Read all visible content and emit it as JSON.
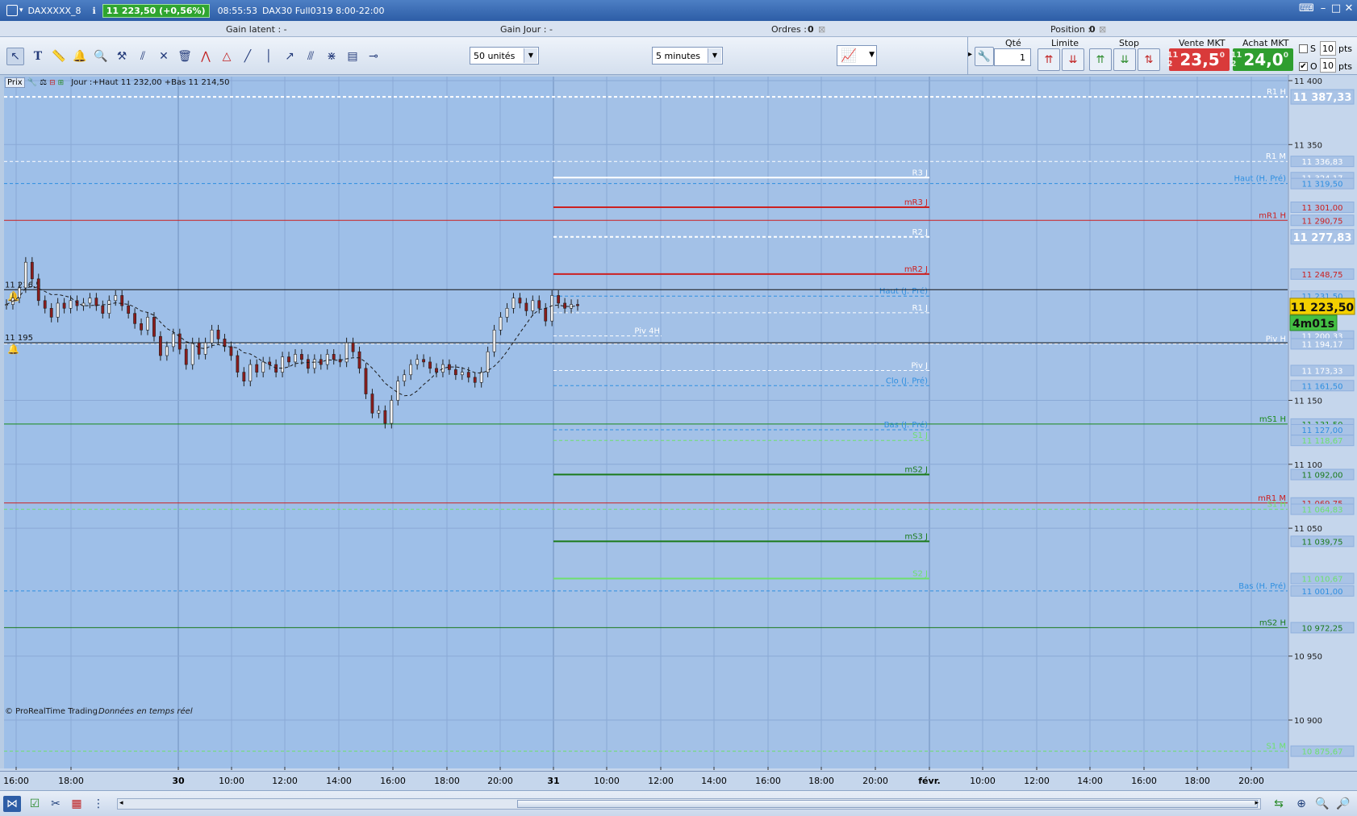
{
  "window": {
    "instrument": "DAXXXXX_8",
    "change": "11 223,50 (+0,56%)",
    "time": "08:55:53",
    "contract": "DAX30 Full0319 8:00-22:00"
  },
  "infobar": {
    "gain_latent": "Gain latent :  -",
    "gain_jour": "Gain Jour :  -",
    "ordres": "Ordres :",
    "ordres_value": "0",
    "position": "Position :",
    "position_value": "0"
  },
  "toolbar": {
    "units_select": "50 unités",
    "timeframe_select": "5 minutes",
    "qty_label": "Qté",
    "qty_value": "1",
    "limit_label": "Limite",
    "stop_label": "Stop",
    "sell_label": "Vente MKT",
    "buy_label": "Achat MKT",
    "sell_prefix": "11 2",
    "sell_price": "23,5",
    "sell_suffix": "0",
    "buy_prefix": "11 2",
    "buy_price": "24,0",
    "buy_suffix": "0",
    "s_label": "S",
    "o_label": "O",
    "s_value": "10",
    "o_value": "10",
    "pts_label": "pts",
    "colors": {
      "sell": "#d93a3a",
      "buy": "#2f9e2f"
    }
  },
  "chart_header": {
    "prix_label": "Prix",
    "jour_text": "Jour :+Haut 11 232,00 +Bas 11 214,50"
  },
  "chart_data": {
    "type": "candlestick",
    "ylim": [
      10870,
      11412
    ],
    "y_ticks": [
      "11 400",
      "11 350",
      "11 150",
      "11 100",
      "11 050",
      "10 950",
      "10 900"
    ],
    "y_tick_values": [
      11400,
      11350,
      11150,
      11100,
      11050,
      10950,
      10900
    ],
    "x_ticks": [
      "16:00",
      "18:00",
      "30",
      "10:00",
      "12:00",
      "14:00",
      "16:00",
      "18:00",
      "20:00",
      "31",
      "10:00",
      "12:00",
      "14:00",
      "16:00",
      "18:00",
      "20:00",
      "févr.",
      "10:00",
      "12:00",
      "14:00",
      "16:00",
      "18:00",
      "20:00"
    ],
    "x_tick_bold": [
      false,
      false,
      true,
      false,
      false,
      false,
      false,
      false,
      false,
      true,
      false,
      false,
      false,
      false,
      false,
      false,
      true,
      false,
      false,
      false,
      false,
      false,
      false
    ],
    "last_price": "11 223,50",
    "countdown": "4m01s",
    "alerts": [
      {
        "label": "11 236,5",
        "value": 11236.5
      },
      {
        "label": "11 195",
        "value": 11195
      }
    ],
    "close_path": [
      [
        0,
        11225
      ],
      [
        2,
        11230
      ],
      [
        4,
        11238
      ],
      [
        6,
        11258
      ],
      [
        8,
        11245
      ],
      [
        10,
        11228
      ],
      [
        12,
        11222
      ],
      [
        14,
        11215
      ],
      [
        16,
        11226
      ],
      [
        18,
        11222
      ],
      [
        20,
        11228
      ],
      [
        22,
        11224
      ],
      [
        24,
        11226
      ],
      [
        26,
        11230
      ],
      [
        28,
        11224
      ],
      [
        30,
        11218
      ],
      [
        32,
        11228
      ],
      [
        34,
        11232
      ],
      [
        36,
        11224
      ],
      [
        38,
        11218
      ],
      [
        40,
        11210
      ],
      [
        42,
        11205
      ],
      [
        44,
        11215
      ],
      [
        46,
        11200
      ],
      [
        48,
        11185
      ],
      [
        50,
        11192
      ],
      [
        52,
        11202
      ],
      [
        54,
        11190
      ],
      [
        56,
        11178
      ],
      [
        58,
        11195
      ],
      [
        60,
        11186
      ],
      [
        62,
        11195
      ],
      [
        64,
        11205
      ],
      [
        66,
        11198
      ],
      [
        68,
        11192
      ],
      [
        70,
        11185
      ],
      [
        72,
        11172
      ],
      [
        74,
        11165
      ],
      [
        76,
        11178
      ],
      [
        78,
        11172
      ],
      [
        80,
        11180
      ],
      [
        82,
        11178
      ],
      [
        84,
        11172
      ],
      [
        86,
        11184
      ],
      [
        88,
        11180
      ],
      [
        90,
        11186
      ],
      [
        92,
        11182
      ],
      [
        94,
        11175
      ],
      [
        96,
        11182
      ],
      [
        98,
        11178
      ],
      [
        100,
        11186
      ],
      [
        102,
        11182
      ],
      [
        104,
        11180
      ],
      [
        106,
        11195
      ],
      [
        108,
        11188
      ],
      [
        110,
        11175
      ],
      [
        112,
        11155
      ],
      [
        114,
        11140
      ],
      [
        116,
        11142
      ],
      [
        118,
        11132
      ],
      [
        120,
        11150
      ],
      [
        122,
        11165
      ],
      [
        124,
        11170
      ],
      [
        126,
        11178
      ],
      [
        128,
        11182
      ],
      [
        130,
        11180
      ],
      [
        132,
        11175
      ],
      [
        134,
        11172
      ],
      [
        136,
        11178
      ],
      [
        138,
        11174
      ],
      [
        140,
        11170
      ],
      [
        142,
        11172
      ],
      [
        144,
        11168
      ],
      [
        146,
        11164
      ],
      [
        148,
        11172
      ],
      [
        150,
        11188
      ],
      [
        152,
        11205
      ],
      [
        154,
        11215
      ],
      [
        156,
        11222
      ],
      [
        158,
        11230
      ],
      [
        160,
        11226
      ],
      [
        162,
        11220
      ],
      [
        164,
        11228
      ],
      [
        166,
        11222
      ],
      [
        168,
        11212
      ],
      [
        170,
        11232
      ],
      [
        172,
        11226
      ],
      [
        174,
        11222
      ],
      [
        176,
        11225
      ],
      [
        178,
        11224
      ]
    ],
    "price_lines": [
      {
        "label": "R1 H",
        "value": 11387.33,
        "color": "#ffffff",
        "style": "dashed",
        "span": "full",
        "tag": "11 387,33",
        "tag_big": true
      },
      {
        "label": "R1 M",
        "value": 11336.83,
        "color": "#ffffff",
        "style": "dashed",
        "span": "full",
        "tag": "11 336,83"
      },
      {
        "label": "R3 J",
        "value": 11324.17,
        "color": "#ffffff",
        "style": "solid",
        "span": "day",
        "tag": "11 324,17"
      },
      {
        "label": "Haut (H. Pré)",
        "value": 11319.5,
        "color": "#2f8fe0",
        "style": "dashed",
        "span": "full",
        "tag": "11 319,50"
      },
      {
        "label": "mR3 J",
        "value": 11301,
        "color": "#cc2020",
        "style": "solid",
        "span": "day",
        "tag": "11 301,00"
      },
      {
        "label": "mR1 H",
        "value": 11290.75,
        "color": "#cc2020",
        "style": "solid",
        "span": "full",
        "tag": "11 290,75"
      },
      {
        "label": "R2 J",
        "value": 11277.83,
        "color": "#ffffff",
        "style": "dashed",
        "span": "day",
        "tag": "11 277,83",
        "tag_big": true
      },
      {
        "label": "mR2 J",
        "value": 11248.75,
        "color": "#cc2020",
        "style": "solid",
        "span": "day",
        "tag": "11 248,75"
      },
      {
        "label": "Haut (J. Pré)",
        "value": 11231.5,
        "color": "#2f8fe0",
        "style": "dashed",
        "span": "day",
        "tag": "11 231,50"
      },
      {
        "label": "R1 J",
        "value": 11218.5,
        "color": "#ffffff",
        "style": "dashed",
        "span": "day",
        "tag": ""
      },
      {
        "label": "Piv 4H",
        "value": 11200.33,
        "color": "#ffffff",
        "style": "dashed",
        "span": "short",
        "tag": "11 200,33"
      },
      {
        "label": "Piv H",
        "value": 11194.17,
        "color": "#ffffff",
        "style": "dashed",
        "span": "full",
        "tag": "11 194,17"
      },
      {
        "label": "Piv J",
        "value": 11173.33,
        "color": "#ffffff",
        "style": "dashed",
        "span": "day",
        "tag": "11 173,33"
      },
      {
        "label": "Clo (J. Pré)",
        "value": 11161.5,
        "color": "#2f8fe0",
        "style": "dashed",
        "span": "day",
        "tag": "11 161,50"
      },
      {
        "label": "mS1 H",
        "value": 11131.5,
        "color": "#1a8a1a",
        "style": "solid",
        "span": "full",
        "tag": "11 131,50"
      },
      {
        "label": "Bas (J. Pré)",
        "value": 11127,
        "color": "#2f8fe0",
        "style": "dashed",
        "span": "day",
        "tag": "11 127,00"
      },
      {
        "label": "S1 J",
        "value": 11118.67,
        "color": "#6ee06e",
        "style": "dashed",
        "span": "day",
        "tag": "11 118,67"
      },
      {
        "label": "mS2 J",
        "value": 11092,
        "color": "#1a7a1a",
        "style": "solid",
        "span": "day",
        "tag": "11 092,00"
      },
      {
        "label": "mR1 M",
        "value": 11069.75,
        "color": "#cc2020",
        "style": "solid",
        "span": "full",
        "tag": "11 069,75"
      },
      {
        "label": "S1 H",
        "value": 11064.83,
        "color": "#6ee06e",
        "style": "dashed",
        "span": "full",
        "tag": "11 064,83"
      },
      {
        "label": "mS3 J",
        "value": 11039.75,
        "color": "#1a7a1a",
        "style": "solid",
        "span": "day",
        "tag": "11 039,75"
      },
      {
        "label": "S2 J",
        "value": 11010.67,
        "color": "#6ee06e",
        "style": "solid",
        "span": "day",
        "tag": "11 010,67"
      },
      {
        "label": "Bas (H. Pré)",
        "value": 11001,
        "color": "#2f8fe0",
        "style": "dashed",
        "span": "full",
        "tag": "11 001,00"
      },
      {
        "label": "mS2 H",
        "value": 10972.25,
        "color": "#1a7a1a",
        "style": "solid",
        "span": "full",
        "tag": "10 972,25"
      },
      {
        "label": "S1 M",
        "value": 10875.67,
        "color": "#6ee06e",
        "style": "dashed",
        "span": "full",
        "tag": "10 875,67"
      }
    ],
    "footer_left": "© ProRealTime Trading",
    "footer_right": "Données en temps réel"
  }
}
